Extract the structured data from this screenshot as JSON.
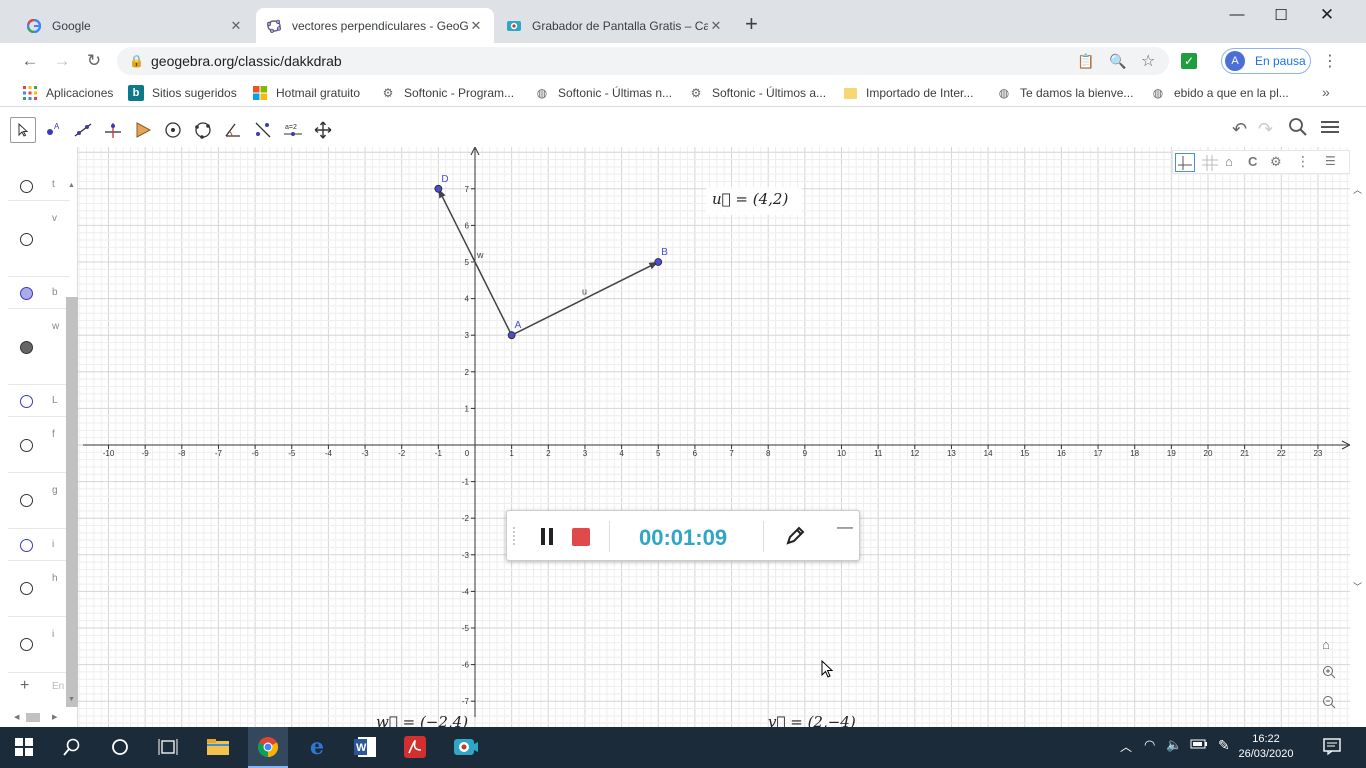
{
  "browser": {
    "tabs": [
      {
        "title": "Google",
        "active": false
      },
      {
        "title": "vectores perpendiculares - GeoG",
        "active": true
      },
      {
        "title": "Grabador de Pantalla Gratis – Ca",
        "active": false
      }
    ],
    "url": "geogebra.org/classic/dakkdrab",
    "profile_initial": "A",
    "profile_label": "En pausa"
  },
  "bookmarks": [
    {
      "label": "Aplicaciones",
      "icon": "apps-grid-icon"
    },
    {
      "label": "Sitios sugeridos",
      "icon": "bing-icon"
    },
    {
      "label": "Hotmail gratuito",
      "icon": "microsoft-icon"
    },
    {
      "label": "Softonic - Program...",
      "icon": "softonic-icon"
    },
    {
      "label": "Softonic - Últimas n...",
      "icon": "globe-icon"
    },
    {
      "label": "Softonic - Últimos a...",
      "icon": "softonic-icon"
    },
    {
      "label": "Importado de Inter...",
      "icon": "folder-icon"
    },
    {
      "label": "Te damos la bienve...",
      "icon": "globe-icon"
    },
    {
      "label": "ebido a que en la pl...",
      "icon": "globe-icon"
    }
  ],
  "geogebra": {
    "algebra_hints": [
      "t",
      "v",
      "b",
      "w",
      "L",
      "f",
      "g",
      "i",
      "h",
      "i"
    ],
    "input_placeholder": "En",
    "u_label": "u⃗ = (4,2)",
    "bottom_left_label": "w⃗ = (−2,4)",
    "bottom_right_label": "v⃗ = (2,−4)",
    "points": [
      {
        "name": "A",
        "x": 1,
        "y": 3
      },
      {
        "name": "B",
        "x": 5,
        "y": 5
      },
      {
        "name": "D",
        "x": -1,
        "y": 7
      }
    ],
    "vectors": [
      {
        "name": "u",
        "from": "A",
        "to": "B"
      },
      {
        "name": "w",
        "from": "A",
        "to": "D"
      }
    ],
    "x_ticks": [
      -10,
      -9,
      -8,
      -7,
      -6,
      -5,
      -4,
      -3,
      -2,
      -1,
      0,
      1,
      2,
      3,
      4,
      5,
      6,
      7,
      8,
      9,
      10,
      11,
      12,
      13,
      14,
      15,
      16,
      17,
      18,
      19,
      20,
      21,
      22,
      23
    ],
    "y_ticks": [
      7,
      6,
      5,
      4,
      3,
      2,
      1,
      -1,
      -2,
      -3,
      -4,
      -5,
      -6,
      -7
    ]
  },
  "recorder": {
    "time": "00:01:09"
  },
  "taskbar": {
    "time": "16:22",
    "date": "26/03/2020"
  }
}
